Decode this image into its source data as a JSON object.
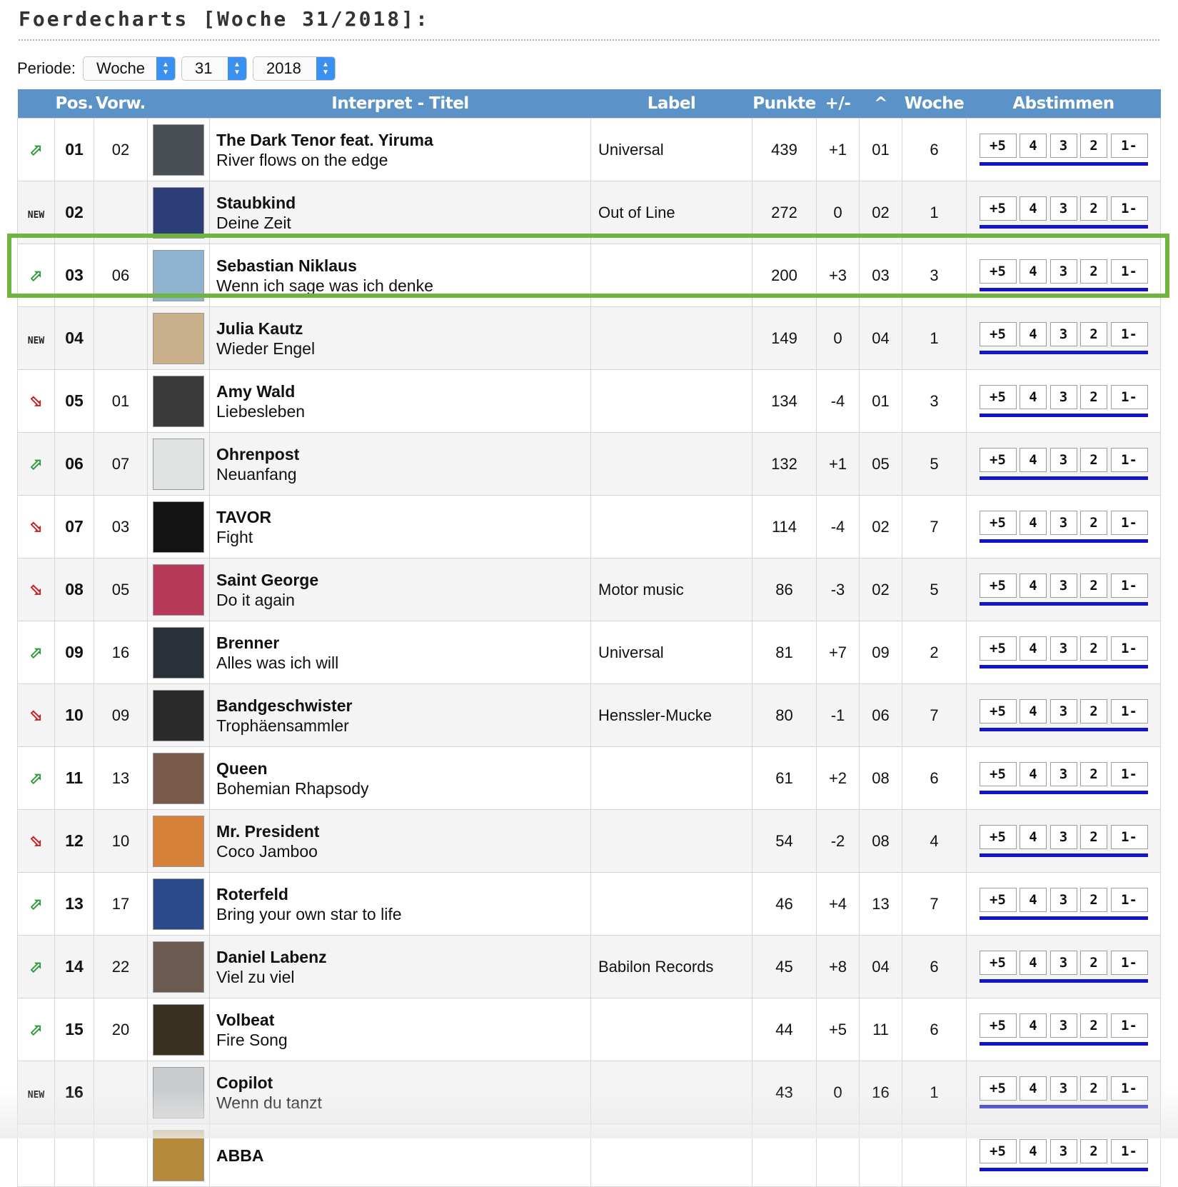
{
  "page": {
    "title": "Foerdecharts [Woche 31/2018]:"
  },
  "period": {
    "label": "Periode:",
    "type_value": "Woche",
    "week_value": "31",
    "year_value": "2018"
  },
  "table": {
    "headers": {
      "pos": "Pos.",
      "prev": "Vorw.",
      "artist_title": "Interpret - Titel",
      "label": "Label",
      "points": "Punkte",
      "change": "+/-",
      "peak": "^",
      "weeks": "Woche",
      "vote": "Abstimmen"
    },
    "vote_options": [
      "+5",
      "4",
      "3",
      "2",
      "1-"
    ],
    "new_badge": "NEW",
    "rows": [
      {
        "trend": "up",
        "pos": "01",
        "prev": "02",
        "artist": "The Dark Tenor feat. Yiruma",
        "title": "River flows on the edge",
        "label": "Universal",
        "points": "439",
        "change": "+1",
        "peak": "01",
        "weeks": "6",
        "cover_color": "#4a4f55"
      },
      {
        "trend": "new",
        "pos": "02",
        "prev": "",
        "artist": "Staubkind",
        "title": "Deine Zeit",
        "label": "Out of Line",
        "points": "272",
        "change": "0",
        "peak": "02",
        "weeks": "1",
        "cover_color": "#2c3e78"
      },
      {
        "trend": "up",
        "pos": "03",
        "prev": "06",
        "artist": "Sebastian Niklaus",
        "title": "Wenn ich sage was ich denke",
        "label": "",
        "points": "200",
        "change": "+3",
        "peak": "03",
        "weeks": "3",
        "cover_color": "#8fb2cf"
      },
      {
        "trend": "new",
        "pos": "04",
        "prev": "",
        "artist": "Julia Kautz",
        "title": "Wieder Engel",
        "label": "",
        "points": "149",
        "change": "0",
        "peak": "04",
        "weeks": "1",
        "cover_color": "#c8b08a"
      },
      {
        "trend": "down",
        "pos": "05",
        "prev": "01",
        "artist": "Amy Wald",
        "title": "Liebesleben",
        "label": "",
        "points": "134",
        "change": "-4",
        "peak": "01",
        "weeks": "3",
        "cover_color": "#3a3a3a"
      },
      {
        "trend": "up",
        "pos": "06",
        "prev": "07",
        "artist": "Ohrenpost",
        "title": "Neuanfang",
        "label": "",
        "points": "132",
        "change": "+1",
        "peak": "05",
        "weeks": "5",
        "cover_color": "#dfe3e2"
      },
      {
        "trend": "down",
        "pos": "07",
        "prev": "03",
        "artist": "TAVOR",
        "title": "Fight",
        "label": "",
        "points": "114",
        "change": "-4",
        "peak": "02",
        "weeks": "7",
        "cover_color": "#141414"
      },
      {
        "trend": "down",
        "pos": "08",
        "prev": "05",
        "artist": "Saint George",
        "title": "Do it again",
        "label": "Motor music",
        "points": "86",
        "change": "-3",
        "peak": "02",
        "weeks": "5",
        "cover_color": "#b83a5a"
      },
      {
        "trend": "up",
        "pos": "09",
        "prev": "16",
        "artist": "Brenner",
        "title": "Alles was ich will",
        "label": "Universal",
        "points": "81",
        "change": "+7",
        "peak": "09",
        "weeks": "2",
        "cover_color": "#2a3038"
      },
      {
        "trend": "down",
        "pos": "10",
        "prev": "09",
        "artist": "Bandgeschwister",
        "title": "Trophäensammler",
        "label": "Henssler-Mucke",
        "points": "80",
        "change": "-1",
        "peak": "06",
        "weeks": "7",
        "cover_color": "#2b2b2b"
      },
      {
        "trend": "up",
        "pos": "11",
        "prev": "13",
        "artist": "Queen",
        "title": "Bohemian Rhapsody",
        "label": "",
        "points": "61",
        "change": "+2",
        "peak": "08",
        "weeks": "6",
        "cover_color": "#7a5a48"
      },
      {
        "trend": "down",
        "pos": "12",
        "prev": "10",
        "artist": "Mr. President",
        "title": "Coco Jamboo",
        "label": "",
        "points": "54",
        "change": "-2",
        "peak": "08",
        "weeks": "4",
        "cover_color": "#d7803a"
      },
      {
        "trend": "up",
        "pos": "13",
        "prev": "17",
        "artist": "Roterfeld",
        "title": "Bring your own star to life",
        "label": "",
        "points": "46",
        "change": "+4",
        "peak": "13",
        "weeks": "7",
        "cover_color": "#2a4a8a"
      },
      {
        "trend": "up",
        "pos": "14",
        "prev": "22",
        "artist": "Daniel Labenz",
        "title": "Viel zu viel",
        "label": "Babilon Records",
        "points": "45",
        "change": "+8",
        "peak": "04",
        "weeks": "6",
        "cover_color": "#6a5a50"
      },
      {
        "trend": "up",
        "pos": "15",
        "prev": "20",
        "artist": "Volbeat",
        "title": "Fire Song",
        "label": "",
        "points": "44",
        "change": "+5",
        "peak": "11",
        "weeks": "6",
        "cover_color": "#3a3020"
      },
      {
        "trend": "new",
        "pos": "16",
        "prev": "",
        "artist": "Copilot",
        "title": "Wenn du tanzt",
        "label": "",
        "points": "43",
        "change": "0",
        "peak": "16",
        "weeks": "1",
        "cover_color": "#c9ccce"
      },
      {
        "trend": "",
        "pos": "",
        "prev": "",
        "artist": "ABBA",
        "title": "",
        "label": "",
        "points": "",
        "change": "",
        "peak": "",
        "weeks": "",
        "cover_color": "#b58a3a"
      }
    ]
  }
}
